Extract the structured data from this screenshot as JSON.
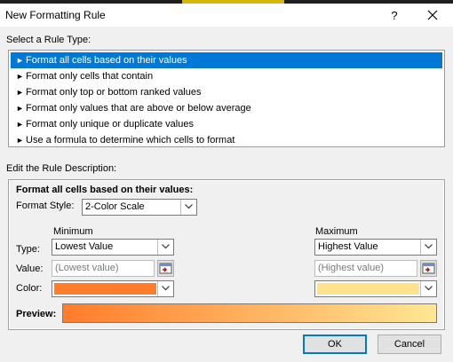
{
  "window": {
    "title": "New Formatting Rule",
    "help": "?"
  },
  "rule_type": {
    "label": "Select a Rule Type:",
    "items": [
      {
        "label": "Format all cells based on their values"
      },
      {
        "label": "Format only cells that contain"
      },
      {
        "label": "Format only top or bottom ranked values"
      },
      {
        "label": "Format only values that are above or below average"
      },
      {
        "label": "Format only unique or duplicate values"
      },
      {
        "label": "Use a formula to determine which cells to format"
      }
    ],
    "selected_index": 0,
    "bullet": "►"
  },
  "description": {
    "label": "Edit the Rule Description:",
    "heading": "Format all cells based on their values:",
    "format_style_label": "Format Style:",
    "format_style_value": "2-Color Scale",
    "minimum": {
      "header": "Minimum",
      "type_value": "Lowest Value",
      "value_placeholder": "(Lowest value)",
      "color": "#ff7c2a"
    },
    "maximum": {
      "header": "Maximum",
      "type_value": "Highest Value",
      "value_placeholder": "(Highest value)",
      "color": "#ffe28a"
    },
    "type_label": "Type:",
    "value_label": "Value:",
    "color_label": "Color:",
    "preview_label": "Preview:"
  },
  "buttons": {
    "ok": "OK",
    "cancel": "Cancel"
  },
  "colors": {
    "selection": "#0078d7",
    "preview_start": "#ff7c2a",
    "preview_end": "#ffe794"
  }
}
